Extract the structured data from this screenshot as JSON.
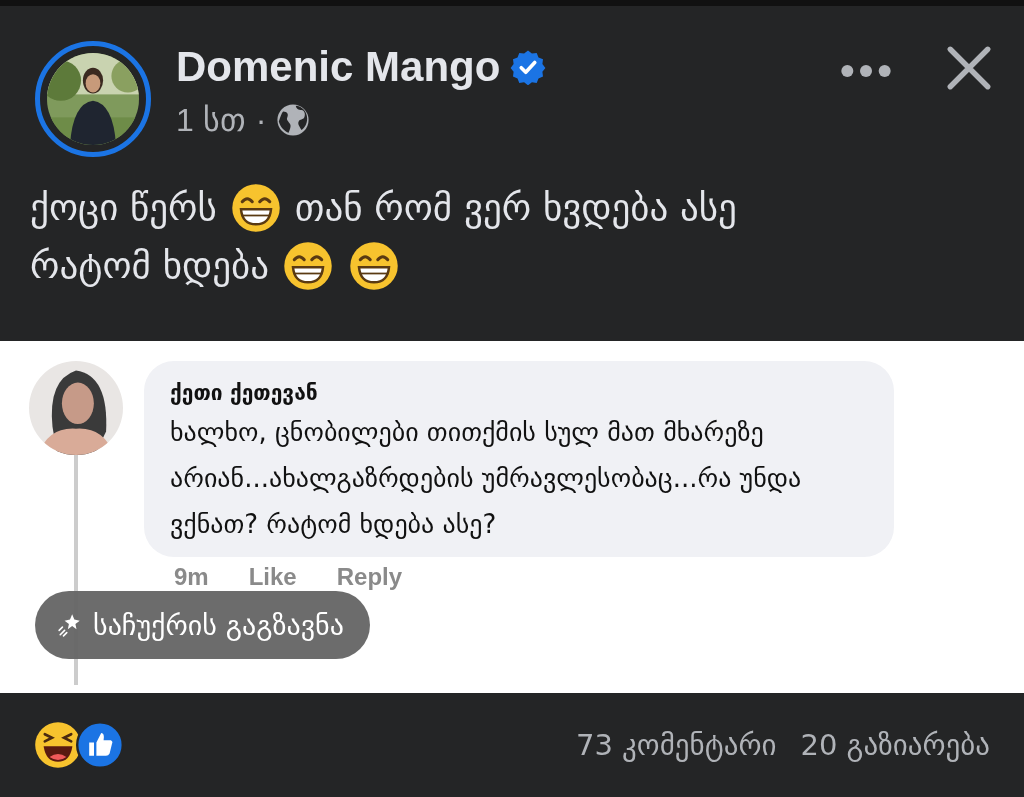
{
  "post": {
    "author": "Domenic Mango",
    "verified": true,
    "time": "1 სთ",
    "separator": "·",
    "lines": [
      [
        {
          "kind": "text",
          "text": "ქოცი წერს"
        },
        {
          "kind": "emoji"
        },
        {
          "kind": "text",
          "text": "თან რომ ვერ ხვდება ასე"
        }
      ],
      [
        {
          "kind": "text",
          "text": "რატომ ხდება"
        },
        {
          "kind": "emoji"
        },
        {
          "kind": "emoji"
        }
      ]
    ]
  },
  "comment": {
    "author": "ქეთი ქეთევან",
    "text": "ხალხო, ცნობილები თითქმის სულ მათ მხარეზე არიან...ახალგაზრდების უმრავლესობაც...რა უნდა ვქნათ? რატომ ხდება ასე?",
    "time": "9m",
    "actions": [
      "Like",
      "Reply"
    ]
  },
  "gift_button": {
    "label": "საჩუქრის გაგზავნა"
  },
  "footer": {
    "comments": "73 კომენტარი",
    "shares": "20 გაზიარება"
  }
}
